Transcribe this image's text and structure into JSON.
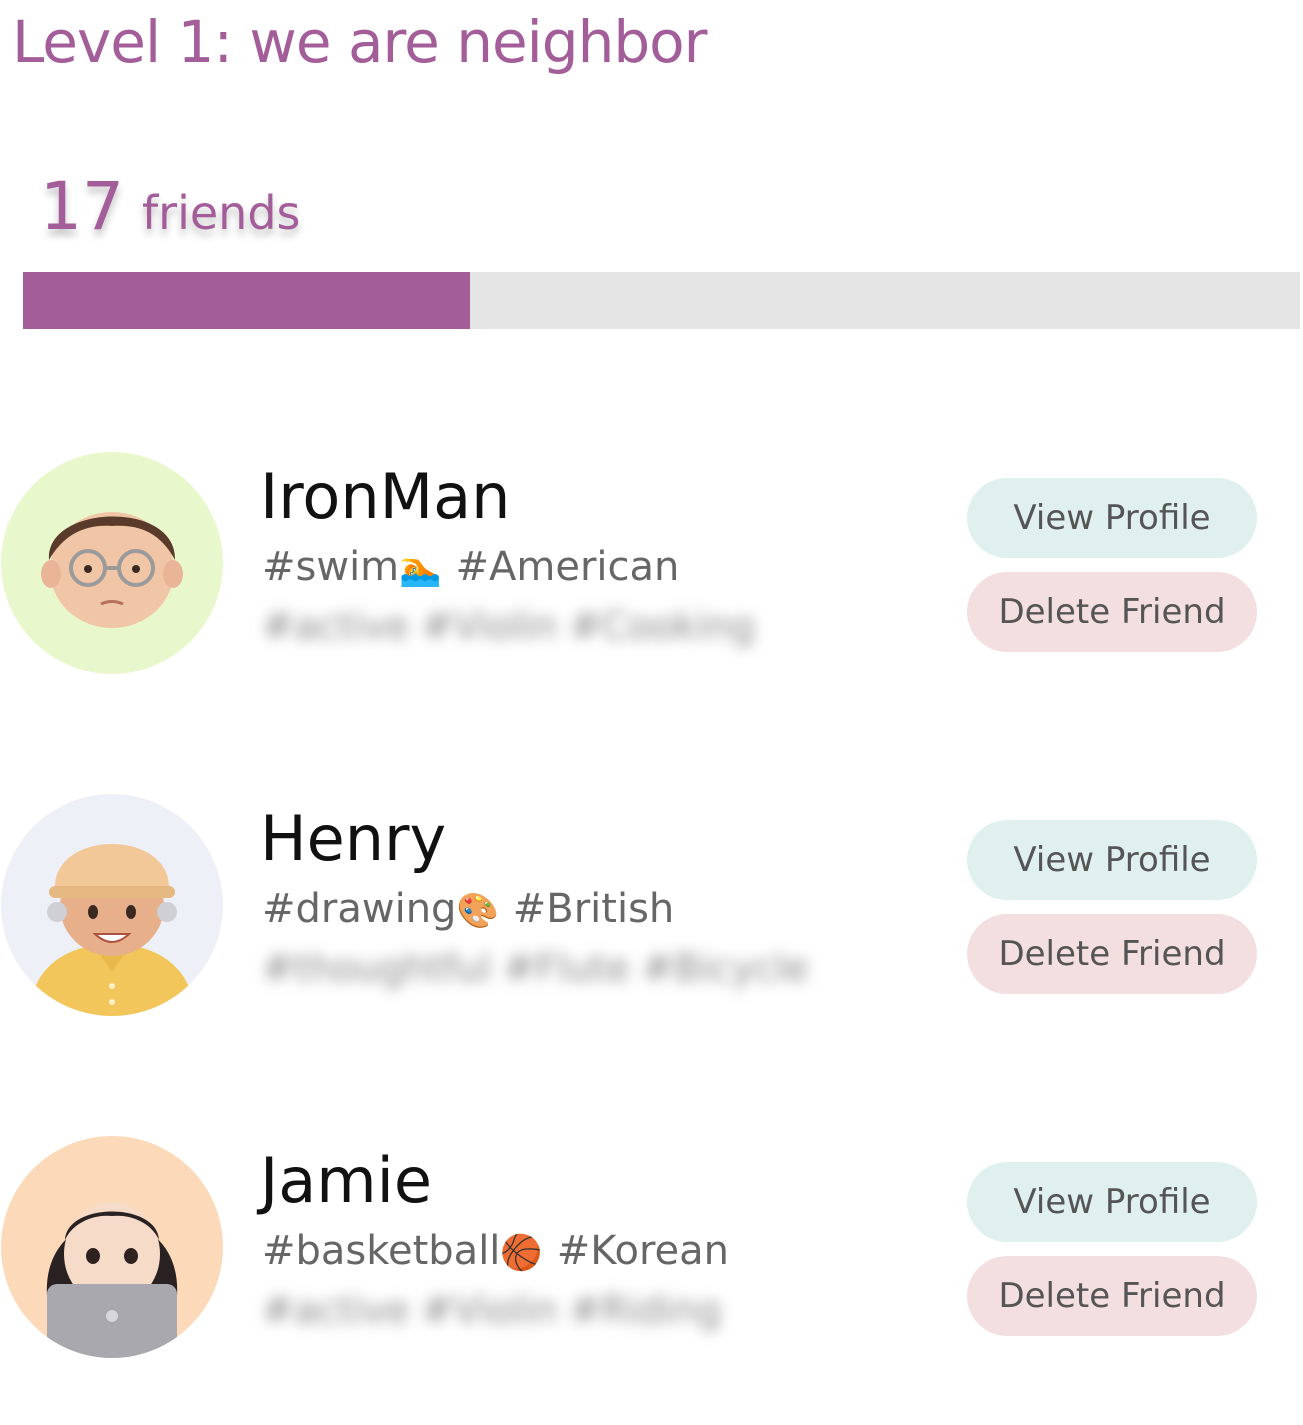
{
  "level": {
    "title": "Level 1: we are neighbor"
  },
  "friends_summary": {
    "count": "17",
    "label": "friends",
    "progress": 0.35
  },
  "buttons": {
    "view_profile": "View Profile",
    "delete_friend": "Delete Friend"
  },
  "friends": [
    {
      "name": "IronMan",
      "tag_primary": "#swim",
      "tag_primary_emoji": "🏊",
      "tag_nationality": "#American",
      "hidden_tags": "#active #Violin #Cooking",
      "avatar_bg": "#e8f8cc",
      "avatar_icon": "memoji-glasses-icon"
    },
    {
      "name": "Henry",
      "tag_primary": "#drawing",
      "tag_primary_emoji": "🎨",
      "tag_nationality": "#British",
      "hidden_tags": "#thoughtful #Flute #Bicycle",
      "avatar_bg": "#edf0f7",
      "avatar_icon": "memoji-cap-icon"
    },
    {
      "name": "Jamie",
      "tag_primary": "#basketball",
      "tag_primary_emoji": "🏀",
      "tag_nationality": "#Korean",
      "hidden_tags": "#active #Violin #Riding",
      "avatar_bg": "#fcd9b8",
      "avatar_icon": "memoji-laptop-icon"
    }
  ],
  "colors": {
    "accent": "#a35e9a",
    "track": "#e5e5e5",
    "view_btn": "#dff0ef",
    "delete_btn": "#f4dfe0"
  }
}
